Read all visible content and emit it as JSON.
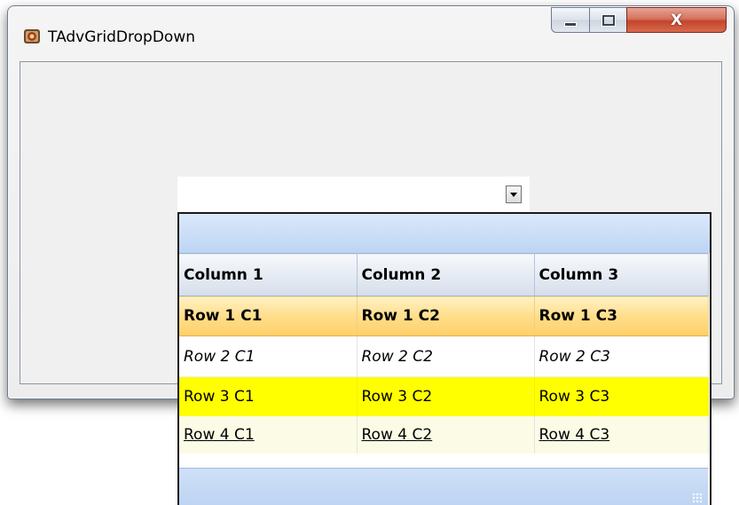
{
  "window": {
    "title": "TAdvGridDropDown",
    "icon": "app-icon",
    "controls": {
      "minimize_icon": "minimize-icon",
      "maximize_icon": "maximize-icon",
      "close_glyph": "X"
    }
  },
  "dropdown": {
    "value": "",
    "button_icon": "chevron-down-icon"
  },
  "grid": {
    "columns": [
      "Column 1",
      "Column 2",
      "Column 3"
    ],
    "rows": [
      [
        "Row 1 C1",
        "Row 1 C2",
        "Row 1 C3"
      ],
      [
        "Row 2 C1",
        "Row 2 C2",
        "Row 2 C3"
      ],
      [
        "Row 3 C1",
        "Row 3 C2",
        "Row 3 C3"
      ],
      [
        "Row 4 C1",
        "Row 4 C2",
        "Row 4 C3"
      ]
    ],
    "row_styles": [
      "bold-selected",
      "italic",
      "yellow-highlight",
      "underline"
    ],
    "colors": {
      "header_band": "#c9dcf6",
      "selected_row": "#ffd97c",
      "highlight_row": "#ffff00",
      "underline_row": "#fbfbe6"
    }
  }
}
